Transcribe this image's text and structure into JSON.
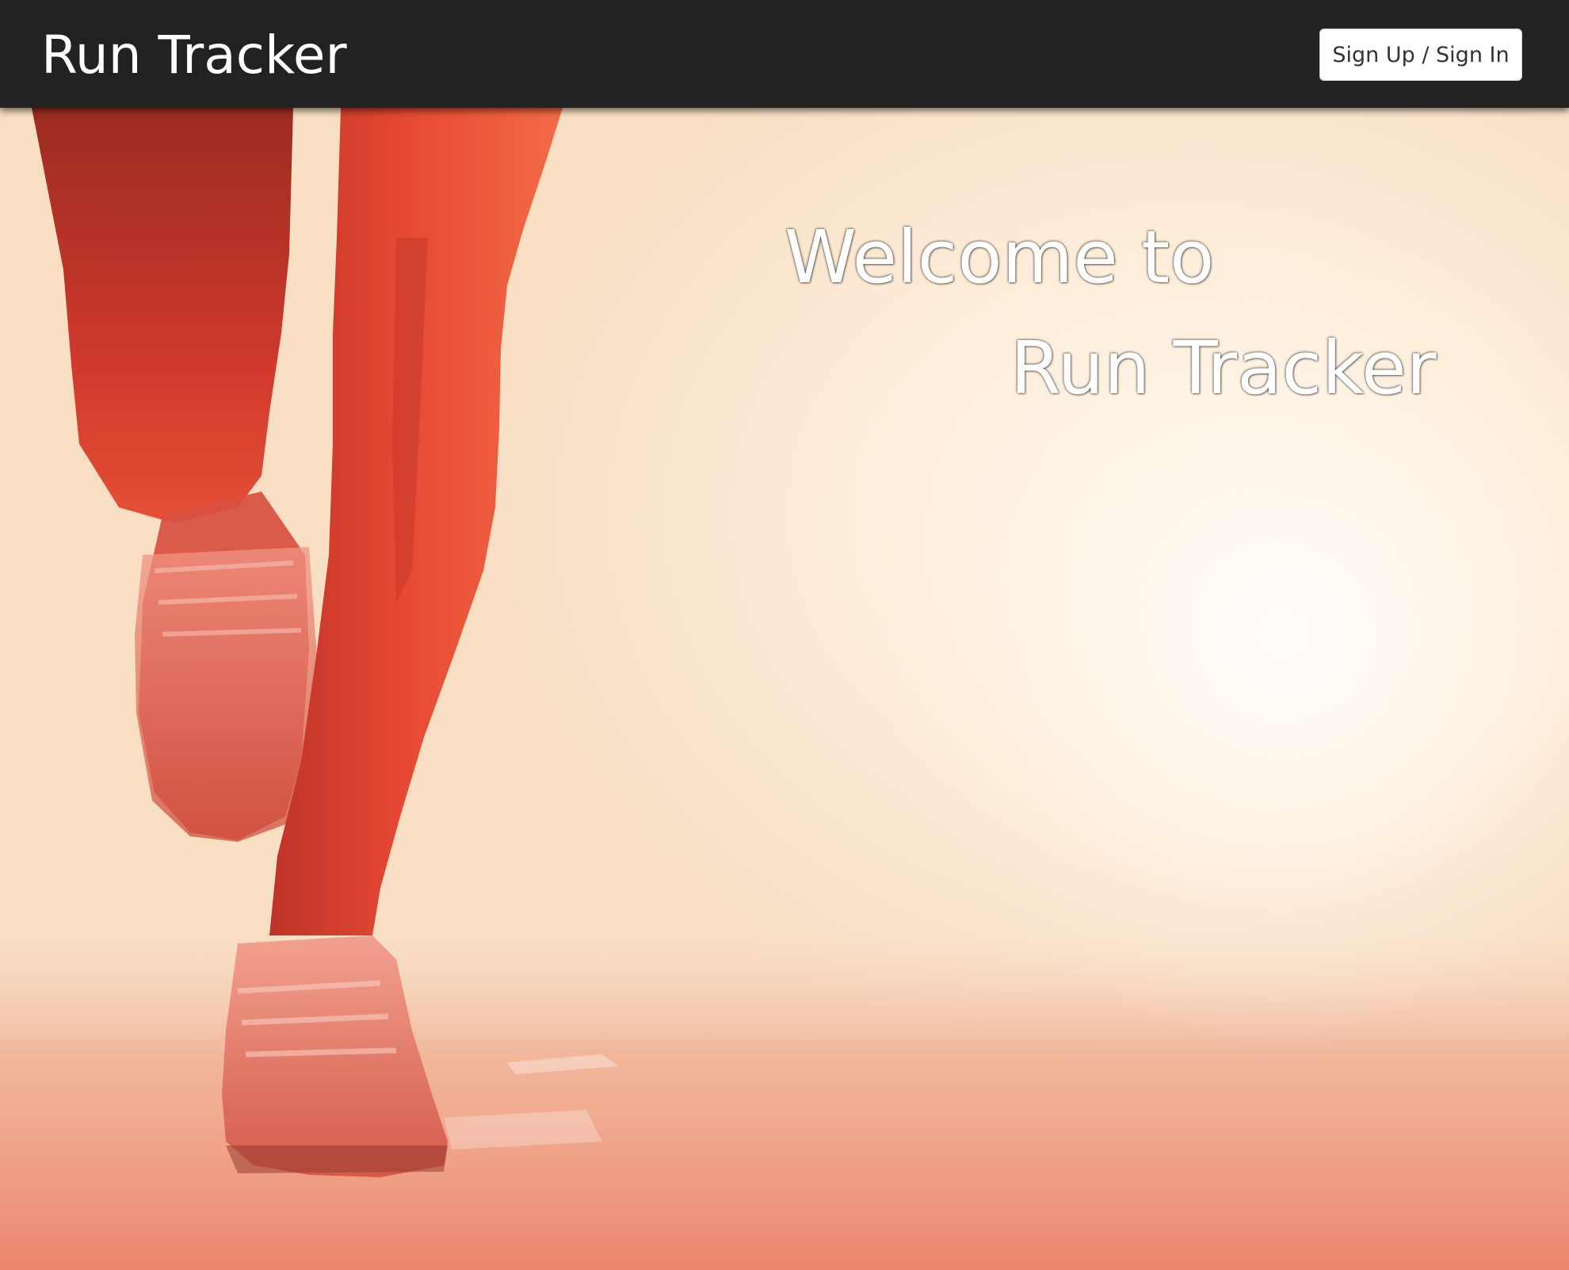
{
  "navbar": {
    "brand": "Run Tracker",
    "auth_button_label": "Sign Up / Sign In"
  },
  "hero": {
    "welcome_line_1": "Welcome to",
    "welcome_line_2": "Run Tracker",
    "background_image": "runner-legs-sunrise"
  },
  "colors": {
    "navbar_bg": "#222222",
    "brand_text": "#ffffff",
    "button_bg": "#ffffff",
    "button_text": "#333333",
    "accent_runner": "#e0341e"
  }
}
